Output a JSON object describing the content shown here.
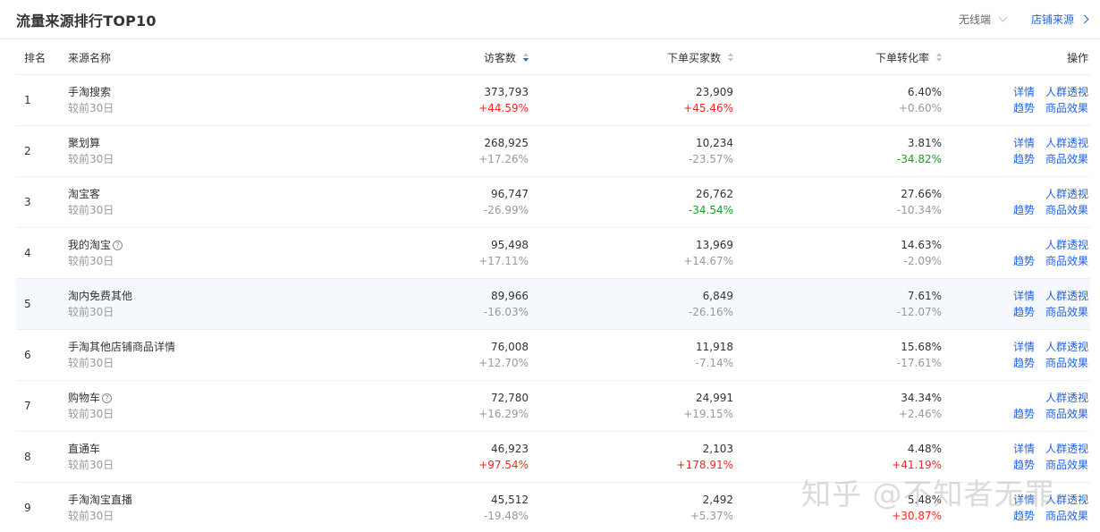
{
  "header": {
    "title": "流量来源排行TOP10",
    "device_select": "无线端",
    "store_source_link": "店铺来源"
  },
  "columns": {
    "rank": "排名",
    "name": "来源名称",
    "visitors": "访客数",
    "orders": "下单买家数",
    "conversion": "下单转化率",
    "actions": "操作"
  },
  "rows": [
    {
      "rank": "1",
      "name": "手淘搜索",
      "compare": "较前30日",
      "visitors": "373,793",
      "visitors_change": "+44.59%",
      "orders": "23,909",
      "orders_change": "+45.46%",
      "conversion": "6.40%",
      "conversion_change": "+0.60%",
      "detail": "详情",
      "crowd": "人群透视",
      "trend": "趋势",
      "goods": "商品效果"
    },
    {
      "rank": "2",
      "name": "聚划算",
      "compare": "较前30日",
      "visitors": "268,925",
      "visitors_change": "+17.26%",
      "orders": "10,234",
      "orders_change": "-23.57%",
      "conversion": "3.81%",
      "conversion_change": "-34.82%",
      "detail": "详情",
      "crowd": "人群透视",
      "trend": "趋势",
      "goods": "商品效果"
    },
    {
      "rank": "3",
      "name": "淘宝客",
      "compare": "较前30日",
      "visitors": "96,747",
      "visitors_change": "-26.99%",
      "orders": "26,762",
      "orders_change": "-34.54%",
      "conversion": "27.66%",
      "conversion_change": "-10.34%",
      "crowd": "人群透视",
      "trend": "趋势",
      "goods": "商品效果"
    },
    {
      "rank": "4",
      "name": "我的淘宝",
      "help": "?",
      "compare": "较前30日",
      "visitors": "95,498",
      "visitors_change": "+17.11%",
      "orders": "13,969",
      "orders_change": "+14.67%",
      "conversion": "14.63%",
      "conversion_change": "-2.09%",
      "crowd": "人群透视",
      "trend": "趋势",
      "goods": "商品效果"
    },
    {
      "rank": "5",
      "name": "淘内免费其他",
      "compare": "较前30日",
      "visitors": "89,966",
      "visitors_change": "-16.03%",
      "orders": "6,849",
      "orders_change": "-26.16%",
      "conversion": "7.61%",
      "conversion_change": "-12.07%",
      "detail": "详情",
      "crowd": "人群透视",
      "trend": "趋势",
      "goods": "商品效果"
    },
    {
      "rank": "6",
      "name": "手淘其他店铺商品详情",
      "compare": "较前30日",
      "visitors": "76,008",
      "visitors_change": "+12.70%",
      "orders": "11,918",
      "orders_change": "-7.14%",
      "conversion": "15.68%",
      "conversion_change": "-17.61%",
      "detail": "详情",
      "crowd": "人群透视",
      "trend": "趋势",
      "goods": "商品效果"
    },
    {
      "rank": "7",
      "name": "购物车",
      "help": "?",
      "compare": "较前30日",
      "visitors": "72,780",
      "visitors_change": "+16.29%",
      "orders": "24,991",
      "orders_change": "+19.15%",
      "conversion": "34.34%",
      "conversion_change": "+2.46%",
      "crowd": "人群透视",
      "trend": "趋势",
      "goods": "商品效果"
    },
    {
      "rank": "8",
      "name": "直通车",
      "compare": "较前30日",
      "visitors": "46,923",
      "visitors_change": "+97.54%",
      "orders": "2,103",
      "orders_change": "+178.91%",
      "conversion": "4.48%",
      "conversion_change": "+41.19%",
      "detail": "详情",
      "crowd": "人群透视",
      "trend": "趋势",
      "goods": "商品效果"
    },
    {
      "rank": "9",
      "name": "手淘淘宝直播",
      "compare": "较前30日",
      "visitors": "45,512",
      "visitors_change": "-19.48%",
      "orders": "2,492",
      "orders_change": "+5.37%",
      "conversion": "5.48%",
      "conversion_change": "+30.87%",
      "detail": "详情",
      "crowd": "人群透视",
      "trend": "趋势",
      "goods": "商品效果"
    }
  ],
  "highlight_colors": {
    "visitors": [
      "red",
      "",
      "",
      "",
      "",
      "",
      "",
      "red",
      ""
    ],
    "orders": [
      "red",
      "",
      "green",
      "",
      "",
      "",
      "",
      "red",
      ""
    ],
    "conversion": [
      "",
      "green",
      "",
      "",
      "",
      "",
      "",
      "red",
      "red"
    ]
  },
  "colors": {
    "link": "#2062e6",
    "up": "#ff2222",
    "down": "#1a9e2a",
    "highlight_row": "#f5f8fd"
  },
  "highlighted_row": 4,
  "watermark": "知乎 @不知者无罪"
}
